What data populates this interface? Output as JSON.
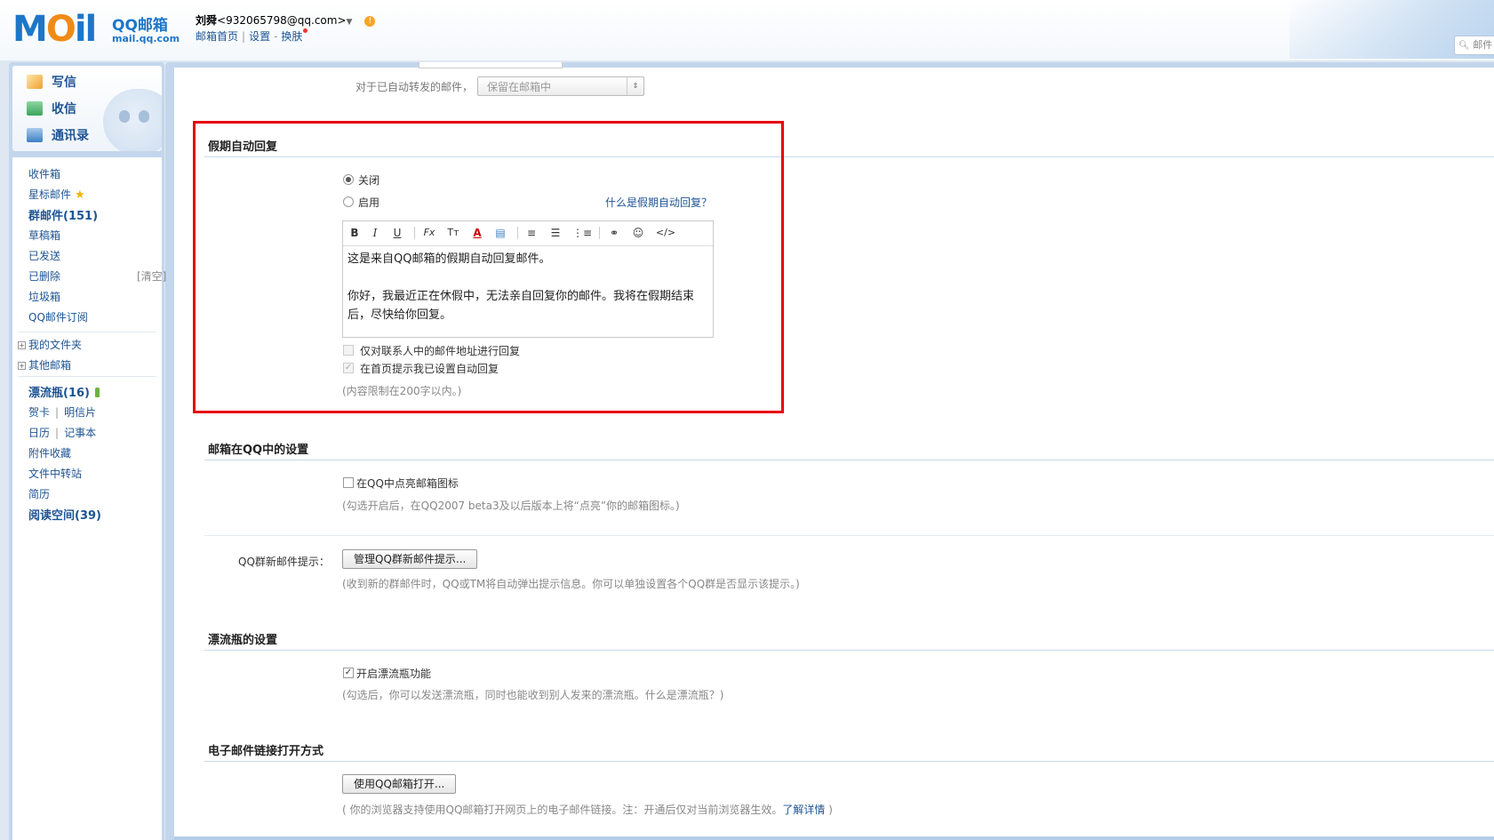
{
  "header": {
    "logo_text": "MOil",
    "brand": "QQ邮箱",
    "domain": "mail.qq.com",
    "user_name": "刘舜",
    "user_email": "<932065798@qq.com>",
    "dropdown": "▼",
    "alert": "!",
    "links": [
      "邮箱首页",
      "设置",
      "换肤"
    ],
    "link_separators": [
      "|",
      "-"
    ],
    "search_placeholder": "邮件"
  },
  "quick_actions": [
    {
      "label": "写信",
      "icon": "compose-icon",
      "color": "#f0a030"
    },
    {
      "label": "收信",
      "icon": "inbox-download-icon",
      "color": "#3aa55c"
    },
    {
      "label": "通讯录",
      "icon": "contacts-icon",
      "color": "#3b7fc4"
    }
  ],
  "folders": {
    "inbox": "收件箱",
    "starred": "星标邮件",
    "starred_icon": "★",
    "groups": "群邮件(151)",
    "drafts": "草稿箱",
    "sent": "已发送",
    "deleted": "已删除",
    "clear": "[清空]",
    "spam": "垃圾箱",
    "subscriptions": "QQ邮件订阅",
    "my_folders": "我的文件夹",
    "other_mailboxes": "其他邮箱",
    "drift_bottle": "漂流瓶(16)",
    "greeting_card": "贺卡",
    "postcard": "明信片",
    "calendar": "日历",
    "notepad": "记事本",
    "attachments": "附件收藏",
    "file_transfer": "文件中转站",
    "resume": "简历",
    "reading_space": "阅读空间(39)",
    "pipe": "|",
    "plus": "+"
  },
  "forward_setting": {
    "label": "对于已自动转发的邮件，",
    "select_value": "保留在邮箱中",
    "select_arrow": "⇕"
  },
  "vacation": {
    "title": "假期自动回复",
    "off_label": "关闭",
    "on_label": "启用",
    "selected": "off",
    "help_link": "什么是假期自动回复？",
    "toolbar": [
      "B",
      "I",
      "U",
      "Fx",
      "Tт",
      "A",
      "▤",
      "≡",
      "☰",
      "⋮≡",
      "⚭",
      "☺",
      "</>"
    ],
    "body_line1": "这是来自QQ邮箱的假期自动回复邮件。",
    "body_line2": "你好，我最近正在休假中，无法亲自回复你的邮件。我将在假期结束后，尽快给你回复。",
    "opt_contacts_only": "仅对联系人中的邮件地址进行回复",
    "opt_contacts_only_checked": false,
    "opt_homepage_notice": "在首页提示我已设置自动回复",
    "opt_homepage_notice_checked": true,
    "limit_hint": "(内容限制在200字以内。)",
    "highlight_color": "#e60012"
  },
  "qq_settings": {
    "title": "邮箱在QQ中的设置",
    "light_icon_label": "在QQ中点亮邮箱图标",
    "light_icon_checked": false,
    "light_icon_hint": "(勾选开启后，在QQ2007 beta3及以后版本上将“点亮”你的邮箱图标。)",
    "group_notify_label": "QQ群新邮件提示：",
    "group_notify_button": "管理QQ群新邮件提示...",
    "group_notify_hint": "(收到新的群邮件时，QQ或TM将自动弹出提示信息。你可以单独设置各个QQ群是否显示该提示。)"
  },
  "drift_settings": {
    "title": "漂流瓶的设置",
    "enable_label": "开启漂流瓶功能",
    "enable_checked": true,
    "hint_prefix": "(勾选后，你可以发送漂流瓶，同时也能收到别人发来的漂流瓶。",
    "hint_link": "什么是漂流瓶？",
    "hint_suffix": ")"
  },
  "link_open": {
    "title": "电子邮件链接打开方式",
    "button": "使用QQ邮箱打开...",
    "hint_prefix": "( 你的浏览器支持使用QQ邮箱打开网页上的电子邮件链接。注：开通后仅对当前浏览器生效。",
    "hint_link": "了解详情",
    "hint_suffix": " )"
  }
}
